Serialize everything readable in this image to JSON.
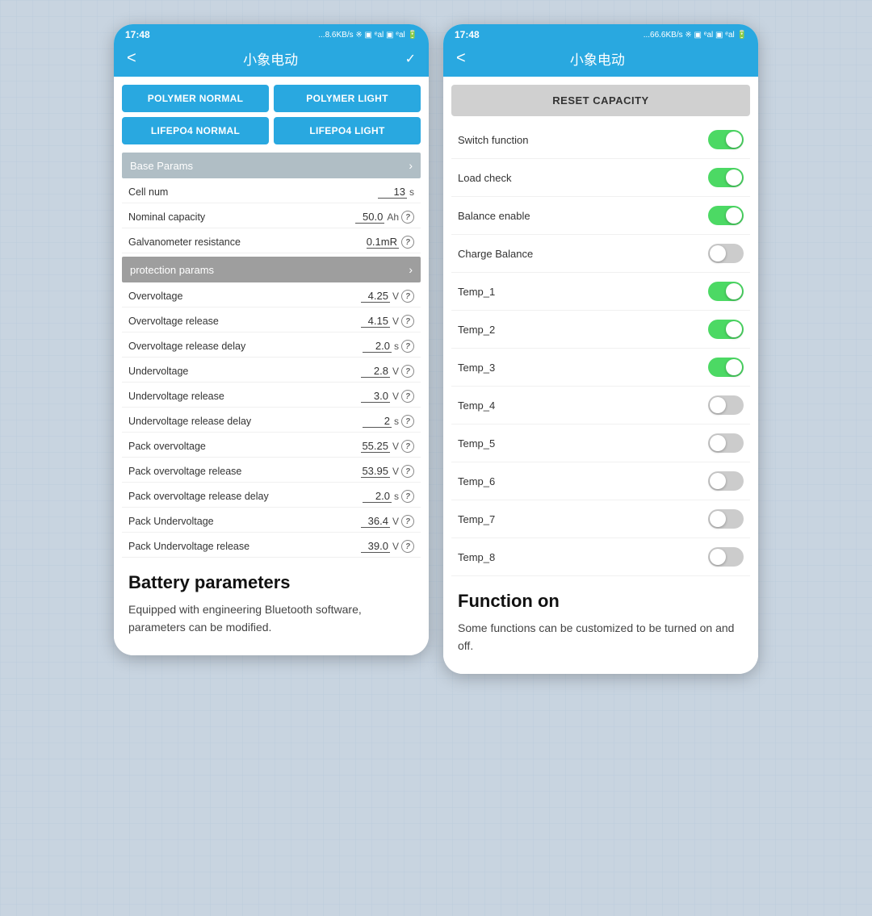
{
  "left_phone": {
    "status_bar": {
      "time": "17:48",
      "signal": "...8.6KB/s ※ ▣ ⁴G⁺al ▣ ⁴G⁺al 🔋"
    },
    "nav": {
      "title": "小象电动",
      "back": "<",
      "right": "✓"
    },
    "mode_buttons": [
      {
        "label": "POLYMER NORMAL",
        "id": "polymer-normal"
      },
      {
        "label": "POLYMER LIGHT",
        "id": "polymer-light"
      },
      {
        "label": "LIFEPO4 NORMAL",
        "id": "lifepo4-normal"
      },
      {
        "label": "LIFEPO4 LIGHT",
        "id": "lifepo4-light"
      }
    ],
    "base_params": {
      "header": "Base Params",
      "params": [
        {
          "label": "Cell num",
          "value": "13",
          "unit": "s"
        },
        {
          "label": "Nominal capacity",
          "value": "50.0",
          "unit": "Ah"
        },
        {
          "label": "Galvanometer resistance",
          "value": "0.1mR",
          "unit": ""
        }
      ]
    },
    "protection_params": {
      "header": "protection params",
      "params": [
        {
          "label": "Overvoltage",
          "value": "4.25",
          "unit": "V"
        },
        {
          "label": "Overvoltage release",
          "value": "4.15",
          "unit": "V"
        },
        {
          "label": "Overvoltage release delay",
          "value": "2.0",
          "unit": "s"
        },
        {
          "label": "Undervoltage",
          "value": "2.8",
          "unit": "V"
        },
        {
          "label": "Undervoltage release",
          "value": "3.0",
          "unit": "V"
        },
        {
          "label": "Undervoltage release delay",
          "value": "2",
          "unit": "s"
        },
        {
          "label": "Pack overvoltage",
          "value": "55.25",
          "unit": "V"
        },
        {
          "label": "Pack overvoltage release",
          "value": "53.95",
          "unit": "V"
        },
        {
          "label": "Pack overvoltage release delay",
          "value": "2.0",
          "unit": "s"
        },
        {
          "label": "Pack Undervoltage",
          "value": "36.4",
          "unit": "V"
        },
        {
          "label": "Pack Undervoltage release",
          "value": "39.0",
          "unit": "V"
        }
      ]
    },
    "caption": {
      "title": "Battery parameters",
      "text": "Equipped with engineering Bluetooth software, parameters can be modified."
    }
  },
  "right_phone": {
    "status_bar": {
      "time": "17:48",
      "signal": "...66.6KB/s ※ ▣ ⁴G⁺al ▣ ⁴G⁺al 🔋"
    },
    "nav": {
      "title": "小象电动",
      "back": "<"
    },
    "reset_button": "RESET CAPACITY",
    "toggles": [
      {
        "label": "Switch function",
        "state": "on"
      },
      {
        "label": "Load check",
        "state": "on"
      },
      {
        "label": "Balance enable",
        "state": "on"
      },
      {
        "label": "Charge Balance",
        "state": "off"
      },
      {
        "label": "Temp_1",
        "state": "on"
      },
      {
        "label": "Temp_2",
        "state": "on"
      },
      {
        "label": "Temp_3",
        "state": "on"
      },
      {
        "label": "Temp_4",
        "state": "off"
      },
      {
        "label": "Temp_5",
        "state": "off"
      },
      {
        "label": "Temp_6",
        "state": "off"
      },
      {
        "label": "Temp_7",
        "state": "off"
      },
      {
        "label": "Temp_8",
        "state": "off"
      }
    ],
    "caption": {
      "title": "Function on",
      "text": "Some functions can be customized to be turned on and off."
    }
  }
}
